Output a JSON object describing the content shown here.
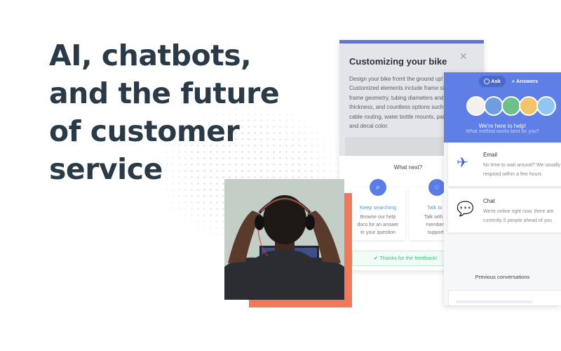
{
  "headline": "AI, chatbots, and the future of customer service",
  "article_card": {
    "title": "Customizing your bike",
    "close_icon": "close-icon",
    "body": "Design your bike fromt the ground up!\nCustomized elements include frame size,\nframe geometry, tubing diameters and\nthickness, and countless options such\ncable routing, water bottle mounts, paint,\nand decal color.",
    "what_next": "What next?",
    "options": [
      {
        "icon": "search-icon",
        "title": "Keep searching",
        "desc": "Browse our help\ndocs for an answer\nto your question"
      },
      {
        "icon": "chat-bubble-icon",
        "title": "Talk to a",
        "desc": "Talk with a f\nmember o\nsupport t"
      }
    ],
    "feedback": "✔  Thanks for the feedback!",
    "accent": "#5b7be8"
  },
  "widget": {
    "tabs": [
      {
        "icon": "chat-bubble-icon",
        "label": "Ask",
        "active": true
      },
      {
        "icon": "search-icon",
        "label": "Answers",
        "active": false
      }
    ],
    "avatar_colors": [
      "#f3f1ef",
      "#6d9ee0",
      "#6cc08a",
      "#f4c46d",
      "#8fc7f2"
    ],
    "heading": "We're here to help!",
    "subheading": "What method works best for you?",
    "methods": [
      {
        "icon": "paper-plane-icon",
        "title": "Email",
        "desc": "No time to wait around? We usually\nrespond within a few hours"
      },
      {
        "icon": "chat-bubbles-icon",
        "title": "Chat",
        "desc": "We're online right now, there are\ncurrently 5 people ahead of you"
      }
    ],
    "previous": "Previous conversations",
    "header_color": "#5f7ee6"
  },
  "accent_orange": "#ef7a59"
}
